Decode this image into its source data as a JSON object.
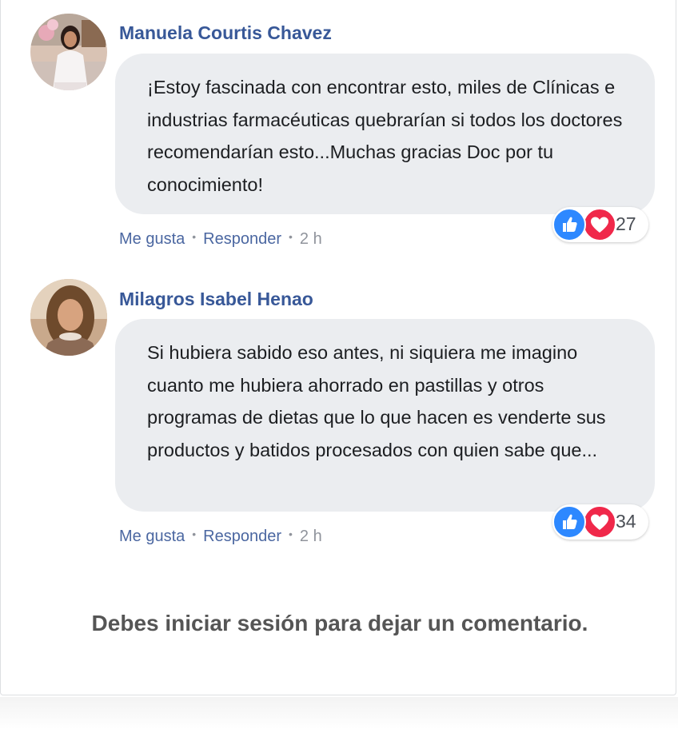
{
  "comments": [
    {
      "author": "Manuela Courtis Chavez",
      "text": "¡Estoy fascinada con encontrar esto, miles de Clínicas e industrias farmacéuticas quebrarían si todos los doctores recomendarían esto...Muchas gracias Doc por tu conocimiento!",
      "like_label": "Me gusta",
      "reply_label": "Responder",
      "time": "2 h",
      "reaction_count": "27",
      "reactions": [
        "like-icon",
        "love-icon"
      ]
    },
    {
      "author": "Milagros Isabel Henao",
      "text": "Si hubiera sabido eso antes, ni siquiera me imagino cuanto me hubiera ahorrado en pastillas y otros programas de dietas que lo que hacen es venderte sus productos y batidos procesados con quien sabe que...",
      "like_label": "Me gusta",
      "reply_label": "Responder",
      "time": "2 h",
      "reaction_count": "34",
      "reactions": [
        "like-icon",
        "love-icon"
      ]
    }
  ],
  "footer": {
    "login_message": "Debes iniciar sesión para dejar un comentario."
  },
  "colors": {
    "author": "#385898",
    "link": "#4b67a1",
    "bubble": "#ebedf0",
    "like": "#2d88ff",
    "love": "#f0284a"
  }
}
